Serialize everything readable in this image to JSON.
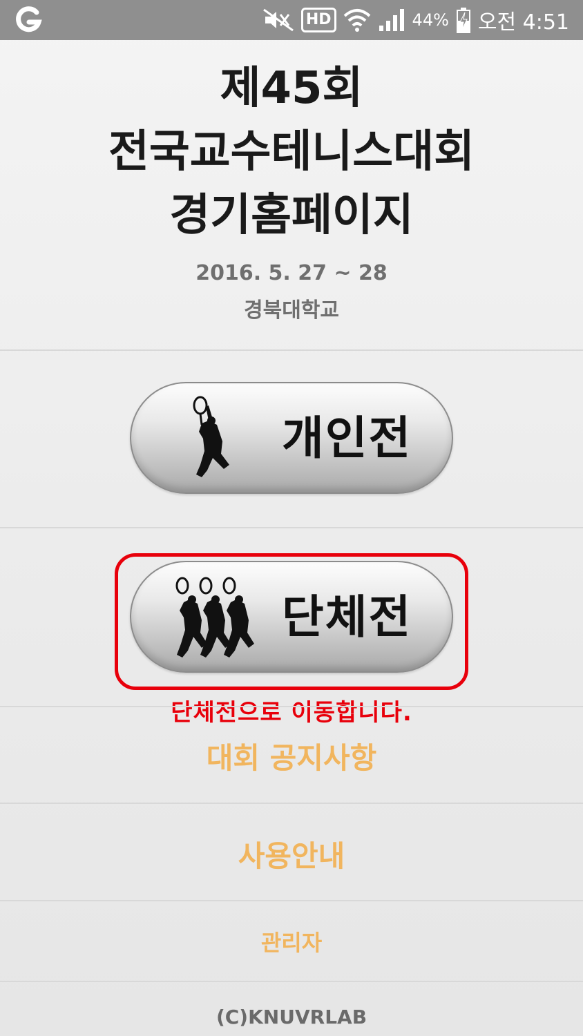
{
  "status_bar": {
    "battery_percent": "44%",
    "time": "오전 4:51",
    "hd_label": "HD",
    "icons": [
      "carrier-logo-icon",
      "mute-icon",
      "hd-voice-icon",
      "wifi-icon",
      "signal-icon",
      "battery-charging-icon"
    ]
  },
  "header": {
    "title_line1": "제45회",
    "title_line2": "전국교수테니스대회",
    "title_line3": "경기홈페이지",
    "date": "2016. 5. 27 ~ 28",
    "location": "경북대학교"
  },
  "buttons": {
    "individual_label": "개인전",
    "team_label": "단체전"
  },
  "annotation": {
    "text": "단체전으로 이동합니다.",
    "color": "#e8000b"
  },
  "menu": {
    "notice": "대회 공지사항",
    "guide": "사용안내",
    "admin": "관리자"
  },
  "footer": {
    "copyright": "(C)KNUVRLAB"
  },
  "colors": {
    "status_bar": "#8f8f8f",
    "menu_link": "#f1b55e",
    "highlight": "#e8000b"
  }
}
